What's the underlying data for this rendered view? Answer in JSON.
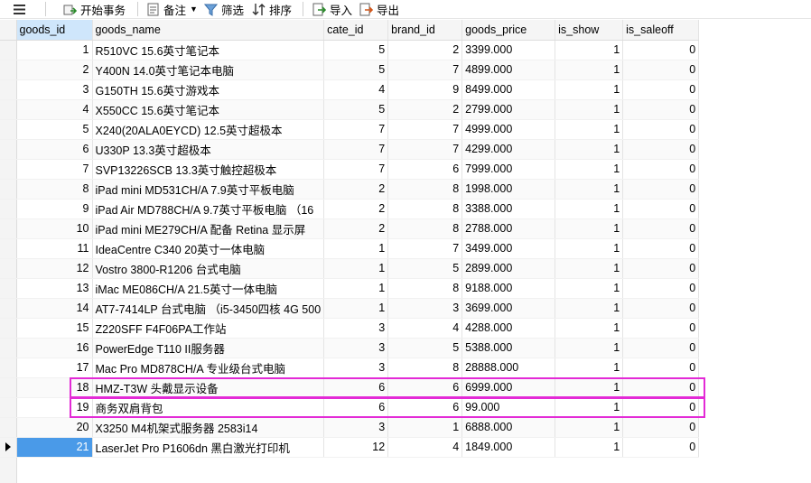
{
  "toolbar": {
    "begin_tx": "开始事务",
    "note": "备注",
    "filter": "筛选",
    "sort": "排序",
    "import": "导入",
    "export": "导出"
  },
  "columns": [
    "goods_id",
    "goods_name",
    "cate_id",
    "brand_id",
    "goods_price",
    "is_show",
    "is_saleoff"
  ],
  "rows": [
    [
      "1",
      "R510VC 15.6英寸笔记本",
      "5",
      "2",
      "3399.000",
      "1",
      "0"
    ],
    [
      "2",
      "Y400N 14.0英寸笔记本电脑",
      "5",
      "7",
      "4899.000",
      "1",
      "0"
    ],
    [
      "3",
      "G150TH 15.6英寸游戏本",
      "4",
      "9",
      "8499.000",
      "1",
      "0"
    ],
    [
      "4",
      "X550CC 15.6英寸笔记本",
      "5",
      "2",
      "2799.000",
      "1",
      "0"
    ],
    [
      "5",
      "X240(20ALA0EYCD) 12.5英寸超极本",
      "7",
      "7",
      "4999.000",
      "1",
      "0"
    ],
    [
      "6",
      "U330P 13.3英寸超极本",
      "7",
      "7",
      "4299.000",
      "1",
      "0"
    ],
    [
      "7",
      "SVP13226SCB 13.3英寸触控超极本",
      "7",
      "6",
      "7999.000",
      "1",
      "0"
    ],
    [
      "8",
      "iPad mini MD531CH/A 7.9英寸平板电脑",
      "2",
      "8",
      "1998.000",
      "1",
      "0"
    ],
    [
      "9",
      "iPad Air MD788CH/A 9.7英寸平板电脑 （16",
      "2",
      "8",
      "3388.000",
      "1",
      "0"
    ],
    [
      "10",
      " iPad mini ME279CH/A 配备 Retina 显示屏",
      "2",
      "8",
      "2788.000",
      "1",
      "0"
    ],
    [
      "11",
      "IdeaCentre C340 20英寸一体电脑",
      "1",
      "7",
      "3499.000",
      "1",
      "0"
    ],
    [
      "12",
      "Vostro 3800-R1206 台式电脑",
      "1",
      "5",
      "2899.000",
      "1",
      "0"
    ],
    [
      "13",
      "iMac ME086CH/A 21.5英寸一体电脑",
      "1",
      "8",
      "9188.000",
      "1",
      "0"
    ],
    [
      "14",
      "AT7-7414LP 台式电脑 （i5-3450四核 4G 500",
      "1",
      "3",
      "3699.000",
      "1",
      "0"
    ],
    [
      "15",
      "Z220SFF F4F06PA工作站",
      "3",
      "4",
      "4288.000",
      "1",
      "0"
    ],
    [
      "16",
      "PowerEdge T110 II服务器",
      "3",
      "5",
      "5388.000",
      "1",
      "0"
    ],
    [
      "17",
      "Mac Pro MD878CH/A 专业级台式电脑",
      "3",
      "8",
      "28888.000",
      "1",
      "0"
    ],
    [
      "18",
      " HMZ-T3W 头戴显示设备",
      "6",
      "6",
      "6999.000",
      "1",
      "0"
    ],
    [
      "19",
      "商务双肩背包",
      "6",
      "6",
      "99.000",
      "1",
      "0"
    ],
    [
      "20",
      "X3250 M4机架式服务器 2583i14",
      "3",
      "1",
      "6888.000",
      "1",
      "0"
    ],
    [
      "21",
      " LaserJet Pro P1606dn 黑白激光打印机",
      "12",
      "4",
      "1849.000",
      "1",
      "0"
    ]
  ],
  "colors": {
    "highlight": "#e32ad6",
    "selection": "#4a9ae8",
    "header_active": "#cfe6fb"
  }
}
